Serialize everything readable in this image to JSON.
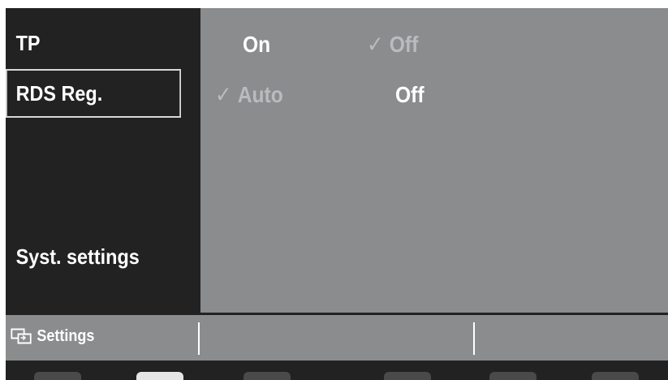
{
  "menu": {
    "items": [
      {
        "label": "TP",
        "selected": false
      },
      {
        "label": "RDS Reg.",
        "selected": true
      },
      {
        "label": "Syst. settings",
        "selected": false
      }
    ]
  },
  "options": {
    "tp": {
      "on_label": "On",
      "off_label": "Off",
      "checked": "Off"
    },
    "rds_reg": {
      "auto_label": "Auto",
      "off_label": "Off",
      "checked": "Auto"
    },
    "check_glyph": "✓"
  },
  "status_bar": {
    "icon": "settings-icon",
    "label": "Settings"
  },
  "softkeys": {
    "count": 6,
    "lit_index": 1
  },
  "colors": {
    "panel_dark": "#222222",
    "pane_gray": "#8a8c8d",
    "text_active": "#ffffff",
    "text_checked": "#b9bcbe"
  }
}
